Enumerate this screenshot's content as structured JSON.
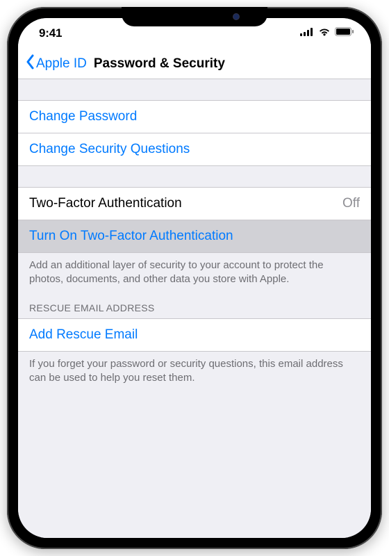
{
  "status": {
    "time": "9:41"
  },
  "nav": {
    "back_label": "Apple ID",
    "title": "Password & Security"
  },
  "group_password": {
    "change_password": "Change Password",
    "change_questions": "Change Security Questions"
  },
  "group_twofa": {
    "row_label": "Two-Factor Authentication",
    "row_value": "Off",
    "turn_on": "Turn On Two-Factor Authentication",
    "footer": "Add an additional layer of security to your account to protect the photos, documents, and other data you store with Apple."
  },
  "group_rescue": {
    "header": "RESCUE EMAIL ADDRESS",
    "add": "Add Rescue Email",
    "footer": "If you forget your password or security questions, this email address can be used to help you reset them."
  }
}
